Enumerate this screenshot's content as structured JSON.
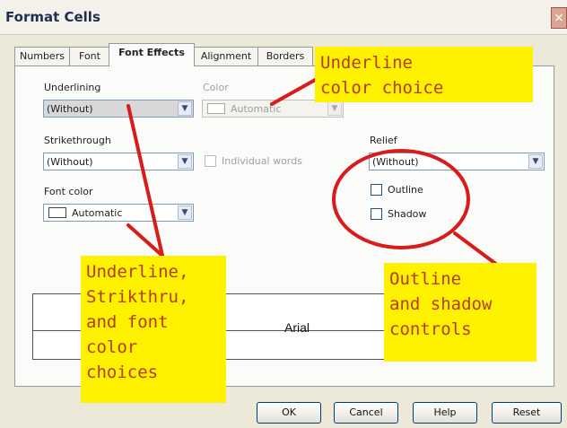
{
  "window": {
    "title": "Format Cells",
    "close_label": "×"
  },
  "tabs": [
    {
      "label": "Numbers",
      "active": false
    },
    {
      "label": "Font",
      "active": false
    },
    {
      "label": "Font Effects",
      "active": true
    },
    {
      "label": "Alignment",
      "active": false
    },
    {
      "label": "Borders",
      "active": false
    }
  ],
  "font_effects": {
    "underlining": {
      "label": "Underlining",
      "value": "(Without)"
    },
    "color": {
      "label": "Color",
      "value": "Automatic",
      "enabled": false
    },
    "strikethrough": {
      "label": "Strikethrough",
      "value": "(Without)"
    },
    "individual_words": {
      "label": "Individual words",
      "checked": false,
      "enabled": false
    },
    "relief": {
      "label": "Relief",
      "value": "(Without)"
    },
    "outline": {
      "label": "Outline",
      "checked": false
    },
    "shadow": {
      "label": "Shadow",
      "checked": false
    },
    "font_color": {
      "label": "Font color",
      "value": "Automatic"
    }
  },
  "preview": {
    "text": "Arial"
  },
  "buttons": {
    "ok": "OK",
    "cancel": "Cancel",
    "help": "Help",
    "reset": "Reset"
  },
  "annotations": {
    "underline_color": "Underline\ncolor choice",
    "left_note": "Underline,\nStrikthru,\nand font\ncolor\nchoices",
    "right_note": "Outline\nand shadow\ncontrols"
  },
  "colors": {
    "annotation_bg": "#fff200",
    "annotation_text": "#b73b10",
    "annotation_ink": "#d81b1b"
  }
}
